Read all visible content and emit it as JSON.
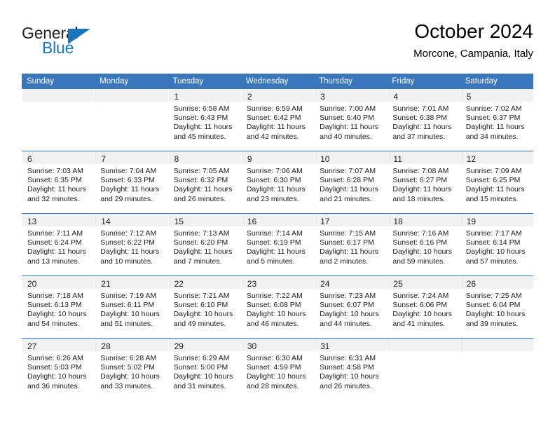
{
  "brand": {
    "name_part1": "General",
    "name_part2": "Blue",
    "accent_color": "#1b75bb"
  },
  "header": {
    "title": "October 2024",
    "location": "Morcone, Campania, Italy"
  },
  "theme": {
    "header_bar_color": "#3a76bb",
    "daynum_band_color": "#f1f1f1",
    "row_divider_color": "#3a76bb"
  },
  "weekdays": [
    "Sunday",
    "Monday",
    "Tuesday",
    "Wednesday",
    "Thursday",
    "Friday",
    "Saturday"
  ],
  "weeks": [
    [
      {
        "day": ""
      },
      {
        "day": ""
      },
      {
        "day": "1",
        "sunrise": "Sunrise: 6:58 AM",
        "sunset": "Sunset: 6:43 PM",
        "daylight": "Daylight: 11 hours and 45 minutes."
      },
      {
        "day": "2",
        "sunrise": "Sunrise: 6:59 AM",
        "sunset": "Sunset: 6:42 PM",
        "daylight": "Daylight: 11 hours and 42 minutes."
      },
      {
        "day": "3",
        "sunrise": "Sunrise: 7:00 AM",
        "sunset": "Sunset: 6:40 PM",
        "daylight": "Daylight: 11 hours and 40 minutes."
      },
      {
        "day": "4",
        "sunrise": "Sunrise: 7:01 AM",
        "sunset": "Sunset: 6:38 PM",
        "daylight": "Daylight: 11 hours and 37 minutes."
      },
      {
        "day": "5",
        "sunrise": "Sunrise: 7:02 AM",
        "sunset": "Sunset: 6:37 PM",
        "daylight": "Daylight: 11 hours and 34 minutes."
      }
    ],
    [
      {
        "day": "6",
        "sunrise": "Sunrise: 7:03 AM",
        "sunset": "Sunset: 6:35 PM",
        "daylight": "Daylight: 11 hours and 32 minutes."
      },
      {
        "day": "7",
        "sunrise": "Sunrise: 7:04 AM",
        "sunset": "Sunset: 6:33 PM",
        "daylight": "Daylight: 11 hours and 29 minutes."
      },
      {
        "day": "8",
        "sunrise": "Sunrise: 7:05 AM",
        "sunset": "Sunset: 6:32 PM",
        "daylight": "Daylight: 11 hours and 26 minutes."
      },
      {
        "day": "9",
        "sunrise": "Sunrise: 7:06 AM",
        "sunset": "Sunset: 6:30 PM",
        "daylight": "Daylight: 11 hours and 23 minutes."
      },
      {
        "day": "10",
        "sunrise": "Sunrise: 7:07 AM",
        "sunset": "Sunset: 6:28 PM",
        "daylight": "Daylight: 11 hours and 21 minutes."
      },
      {
        "day": "11",
        "sunrise": "Sunrise: 7:08 AM",
        "sunset": "Sunset: 6:27 PM",
        "daylight": "Daylight: 11 hours and 18 minutes."
      },
      {
        "day": "12",
        "sunrise": "Sunrise: 7:09 AM",
        "sunset": "Sunset: 6:25 PM",
        "daylight": "Daylight: 11 hours and 15 minutes."
      }
    ],
    [
      {
        "day": "13",
        "sunrise": "Sunrise: 7:11 AM",
        "sunset": "Sunset: 6:24 PM",
        "daylight": "Daylight: 11 hours and 13 minutes."
      },
      {
        "day": "14",
        "sunrise": "Sunrise: 7:12 AM",
        "sunset": "Sunset: 6:22 PM",
        "daylight": "Daylight: 11 hours and 10 minutes."
      },
      {
        "day": "15",
        "sunrise": "Sunrise: 7:13 AM",
        "sunset": "Sunset: 6:20 PM",
        "daylight": "Daylight: 11 hours and 7 minutes."
      },
      {
        "day": "16",
        "sunrise": "Sunrise: 7:14 AM",
        "sunset": "Sunset: 6:19 PM",
        "daylight": "Daylight: 11 hours and 5 minutes."
      },
      {
        "day": "17",
        "sunrise": "Sunrise: 7:15 AM",
        "sunset": "Sunset: 6:17 PM",
        "daylight": "Daylight: 11 hours and 2 minutes."
      },
      {
        "day": "18",
        "sunrise": "Sunrise: 7:16 AM",
        "sunset": "Sunset: 6:16 PM",
        "daylight": "Daylight: 10 hours and 59 minutes."
      },
      {
        "day": "19",
        "sunrise": "Sunrise: 7:17 AM",
        "sunset": "Sunset: 6:14 PM",
        "daylight": "Daylight: 10 hours and 57 minutes."
      }
    ],
    [
      {
        "day": "20",
        "sunrise": "Sunrise: 7:18 AM",
        "sunset": "Sunset: 6:13 PM",
        "daylight": "Daylight: 10 hours and 54 minutes."
      },
      {
        "day": "21",
        "sunrise": "Sunrise: 7:19 AM",
        "sunset": "Sunset: 6:11 PM",
        "daylight": "Daylight: 10 hours and 51 minutes."
      },
      {
        "day": "22",
        "sunrise": "Sunrise: 7:21 AM",
        "sunset": "Sunset: 6:10 PM",
        "daylight": "Daylight: 10 hours and 49 minutes."
      },
      {
        "day": "23",
        "sunrise": "Sunrise: 7:22 AM",
        "sunset": "Sunset: 6:08 PM",
        "daylight": "Daylight: 10 hours and 46 minutes."
      },
      {
        "day": "24",
        "sunrise": "Sunrise: 7:23 AM",
        "sunset": "Sunset: 6:07 PM",
        "daylight": "Daylight: 10 hours and 44 minutes."
      },
      {
        "day": "25",
        "sunrise": "Sunrise: 7:24 AM",
        "sunset": "Sunset: 6:06 PM",
        "daylight": "Daylight: 10 hours and 41 minutes."
      },
      {
        "day": "26",
        "sunrise": "Sunrise: 7:25 AM",
        "sunset": "Sunset: 6:04 PM",
        "daylight": "Daylight: 10 hours and 39 minutes."
      }
    ],
    [
      {
        "day": "27",
        "sunrise": "Sunrise: 6:26 AM",
        "sunset": "Sunset: 5:03 PM",
        "daylight": "Daylight: 10 hours and 36 minutes."
      },
      {
        "day": "28",
        "sunrise": "Sunrise: 6:28 AM",
        "sunset": "Sunset: 5:02 PM",
        "daylight": "Daylight: 10 hours and 33 minutes."
      },
      {
        "day": "29",
        "sunrise": "Sunrise: 6:29 AM",
        "sunset": "Sunset: 5:00 PM",
        "daylight": "Daylight: 10 hours and 31 minutes."
      },
      {
        "day": "30",
        "sunrise": "Sunrise: 6:30 AM",
        "sunset": "Sunset: 4:59 PM",
        "daylight": "Daylight: 10 hours and 28 minutes."
      },
      {
        "day": "31",
        "sunrise": "Sunrise: 6:31 AM",
        "sunset": "Sunset: 4:58 PM",
        "daylight": "Daylight: 10 hours and 26 minutes."
      },
      {
        "day": ""
      },
      {
        "day": ""
      }
    ]
  ]
}
